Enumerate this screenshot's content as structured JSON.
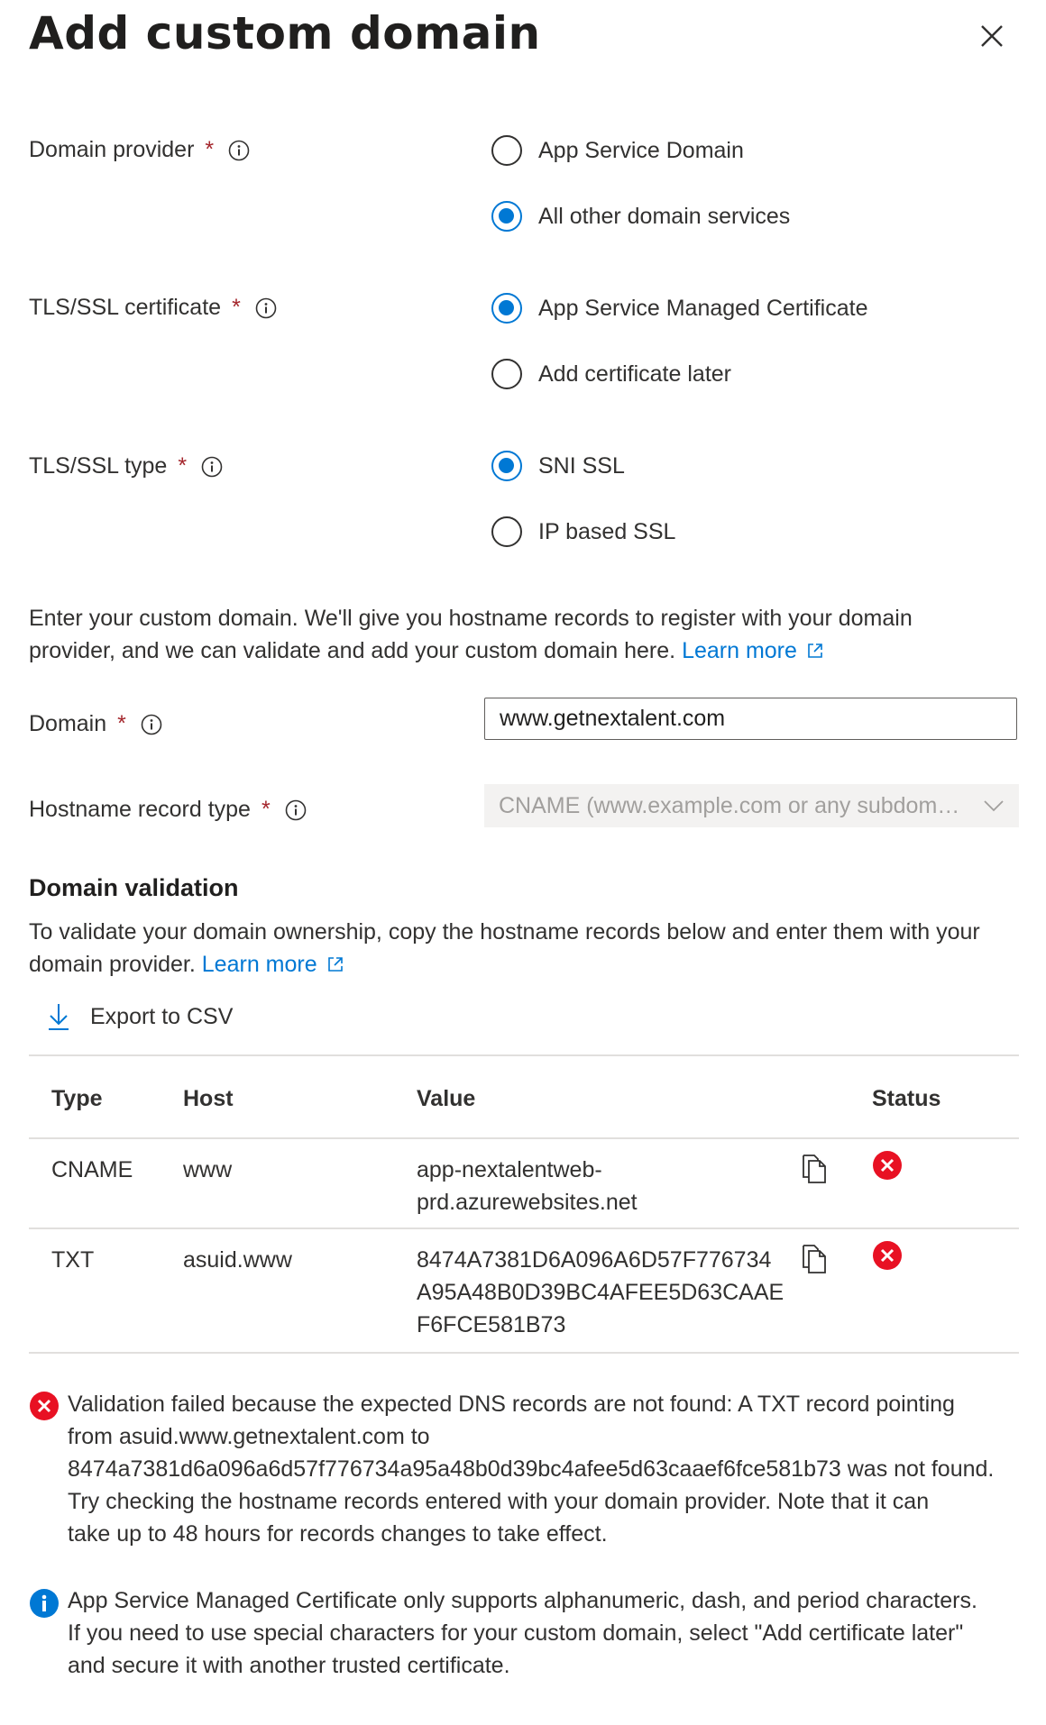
{
  "panel": {
    "title": "Add custom domain"
  },
  "domain_provider": {
    "label": "Domain provider",
    "required": "*",
    "options": [
      {
        "label": "App Service Domain",
        "selected": false
      },
      {
        "label": "All other domain services",
        "selected": true
      }
    ]
  },
  "tls_certificate": {
    "label": "TLS/SSL certificate",
    "required": "*",
    "options": [
      {
        "label": "App Service Managed Certificate",
        "selected": true
      },
      {
        "label": "Add certificate later",
        "selected": false
      }
    ]
  },
  "tls_type": {
    "label": "TLS/SSL type",
    "required": "*",
    "options": [
      {
        "label": "SNI SSL",
        "selected": true
      },
      {
        "label": "IP based SSL",
        "selected": false
      }
    ]
  },
  "intro": {
    "text": "Enter your custom domain. We'll give you hostname records to register with your domain provider, and we can validate and add your custom domain here.",
    "link": "Learn more"
  },
  "domain_field": {
    "label": "Domain",
    "required": "*",
    "value": "www.getnextalent.com"
  },
  "hostname_record_type": {
    "label": "Hostname record type",
    "required": "*",
    "value": "CNAME (www.example.com or any subdomain)"
  },
  "validation": {
    "heading": "Domain validation",
    "text": "To validate your domain ownership, copy the hostname records below and enter them with your domain provider.",
    "link": "Learn more",
    "export_label": "Export to CSV"
  },
  "records_table": {
    "headers": [
      "Type",
      "Host",
      "Value",
      "Status"
    ],
    "rows": [
      {
        "type": "CNAME",
        "host": "www",
        "value_lines": [
          "app-nextalentweb-",
          "prd.azurewebsites.net"
        ],
        "status": "error"
      },
      {
        "type": "TXT",
        "host": "asuid.www",
        "value_lines": [
          "8474A7381D6A096A6D57F776734",
          "A95A48B0D39BC4AFEE5D63CAAE",
          "F6FCE581B73"
        ],
        "status": "error"
      }
    ]
  },
  "error_message": {
    "lines": [
      "Validation failed because the expected DNS records are not found: A TXT record pointing",
      "from asuid.www.getnextalent.com to",
      "8474a7381d6a096a6d57f776734a95a48b0d39bc4afee5d63caaef6fce581b73 was not found.",
      "Try checking the hostname records entered with your domain provider. Note that it can",
      "take up to 48 hours for records changes to take effect."
    ]
  },
  "info_message": {
    "lines": [
      "App Service Managed Certificate only supports alphanumeric, dash, and period characters.",
      "If you need to use special characters for your custom domain, select \"Add certificate later\"",
      "and secure it with another trusted certificate."
    ]
  },
  "colors": {
    "accent": "#0078d4",
    "error": "#e81123",
    "required": "#a4262c"
  }
}
